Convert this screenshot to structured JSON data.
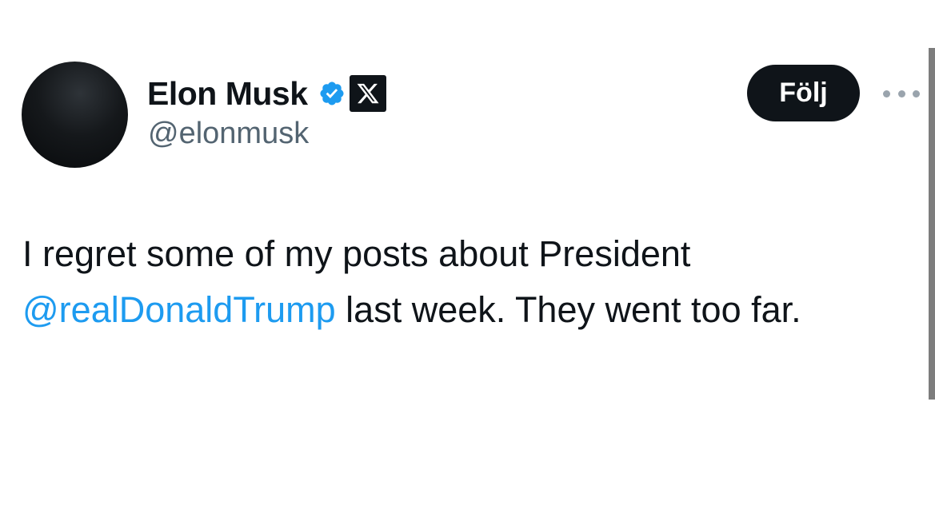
{
  "author": {
    "name": "Elon Musk",
    "handle": "@elonmusk",
    "verified_icon": "verified-badge-icon",
    "affiliate_icon": "x-logo-icon"
  },
  "actions": {
    "follow_label": "Följ",
    "more_icon": "more-options-icon"
  },
  "tweet": {
    "line1": "I regret some of my posts about President",
    "mention": "@realDonaldTrump",
    "line2_rest": " last week. They went too far."
  },
  "colors": {
    "text": "#0f1419",
    "secondary": "#536471",
    "mention": "#1d9bf0",
    "verified": "#1d9bf0",
    "button_bg": "#0f1419",
    "button_text": "#ffffff"
  }
}
